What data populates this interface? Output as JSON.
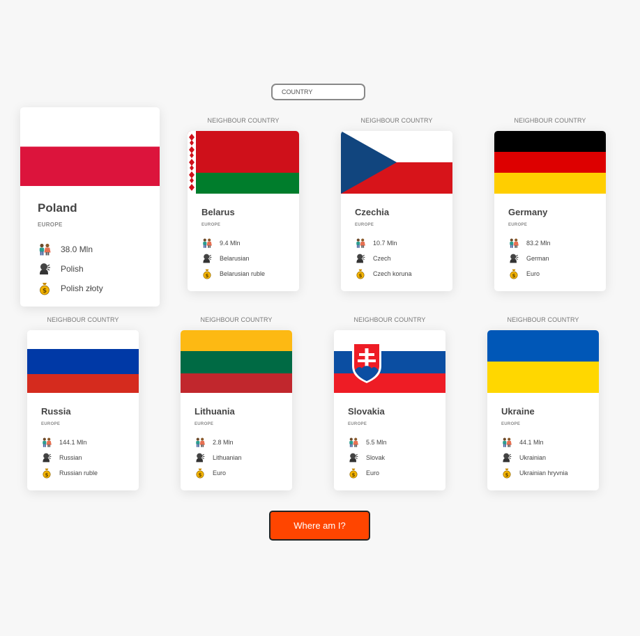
{
  "search": {
    "placeholder": "COUNTRY",
    "value": ""
  },
  "main_country": {
    "name": "Poland",
    "region": "EUROPE",
    "population": "38.0 Mln",
    "language": "Polish",
    "currency": "Polish złoty",
    "flag": "poland-flag"
  },
  "neighbour_label": "NEIGHBOUR COUNTRY",
  "neighbours": [
    {
      "name": "Belarus",
      "region": "EUROPE",
      "population": "9.4 Mln",
      "language": "Belarusian",
      "currency": "Belarusian ruble",
      "flag": "belarus-flag"
    },
    {
      "name": "Czechia",
      "region": "EUROPE",
      "population": "10.7 Mln",
      "language": "Czech",
      "currency": "Czech koruna",
      "flag": "czechia-flag"
    },
    {
      "name": "Germany",
      "region": "EUROPE",
      "population": "83.2 Mln",
      "language": "German",
      "currency": "Euro",
      "flag": "germany-flag"
    },
    {
      "name": "Russia",
      "region": "EUROPE",
      "population": "144.1 Mln",
      "language": "Russian",
      "currency": "Russian ruble",
      "flag": "russia-flag"
    },
    {
      "name": "Lithuania",
      "region": "EUROPE",
      "population": "2.8 Mln",
      "language": "Lithuanian",
      "currency": "Euro",
      "flag": "lithuania-flag"
    },
    {
      "name": "Slovakia",
      "region": "EUROPE",
      "population": "5.5 Mln",
      "language": "Slovak",
      "currency": "Euro",
      "flag": "slovakia-flag"
    },
    {
      "name": "Ukraine",
      "region": "EUROPE",
      "population": "44.1 Mln",
      "language": "Ukrainian",
      "currency": "Ukrainian hryvnia",
      "flag": "ukraine-flag"
    }
  ],
  "icons": {
    "population": "people-icon",
    "language": "speaking-head-icon",
    "currency": "money-bag-icon"
  },
  "colors": {
    "button": "#ff4500",
    "background": "#f7f7f7"
  },
  "button": {
    "label": "Where am I?"
  }
}
